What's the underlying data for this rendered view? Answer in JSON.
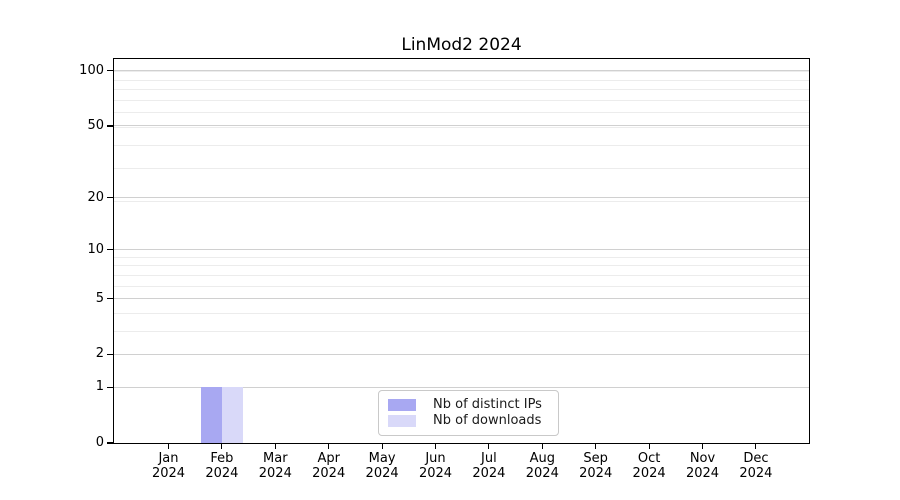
{
  "chart_data": {
    "type": "bar",
    "title": "LinMod2 2024",
    "categories": [
      {
        "month": "Jan",
        "year": "2024"
      },
      {
        "month": "Feb",
        "year": "2024"
      },
      {
        "month": "Mar",
        "year": "2024"
      },
      {
        "month": "Apr",
        "year": "2024"
      },
      {
        "month": "May",
        "year": "2024"
      },
      {
        "month": "Jun",
        "year": "2024"
      },
      {
        "month": "Jul",
        "year": "2024"
      },
      {
        "month": "Aug",
        "year": "2024"
      },
      {
        "month": "Sep",
        "year": "2024"
      },
      {
        "month": "Oct",
        "year": "2024"
      },
      {
        "month": "Nov",
        "year": "2024"
      },
      {
        "month": "Dec",
        "year": "2024"
      }
    ],
    "series": [
      {
        "name": "Nb of distinct IPs",
        "color": "#a8a8f2",
        "values": [
          0,
          1,
          0,
          0,
          0,
          0,
          0,
          0,
          0,
          0,
          0,
          0
        ]
      },
      {
        "name": "Nb of downloads",
        "color": "#d9d9f9",
        "values": [
          0,
          1,
          0,
          0,
          0,
          0,
          0,
          0,
          0,
          0,
          0,
          0
        ]
      }
    ],
    "y_scale": "log1p",
    "y_ticks": [
      0,
      1,
      2,
      5,
      10,
      20,
      50,
      100
    ],
    "y_minor_ticks": [
      3,
      4,
      6,
      7,
      8,
      9,
      19,
      29,
      39,
      49,
      59,
      69,
      79,
      89,
      99
    ],
    "ylim": [
      0,
      116
    ],
    "grid": "horizontal",
    "legend_position": "lower center",
    "colors": {
      "grid_major": "#d0d0d0",
      "grid_minor": "#ececec",
      "axis": "#000000"
    }
  }
}
